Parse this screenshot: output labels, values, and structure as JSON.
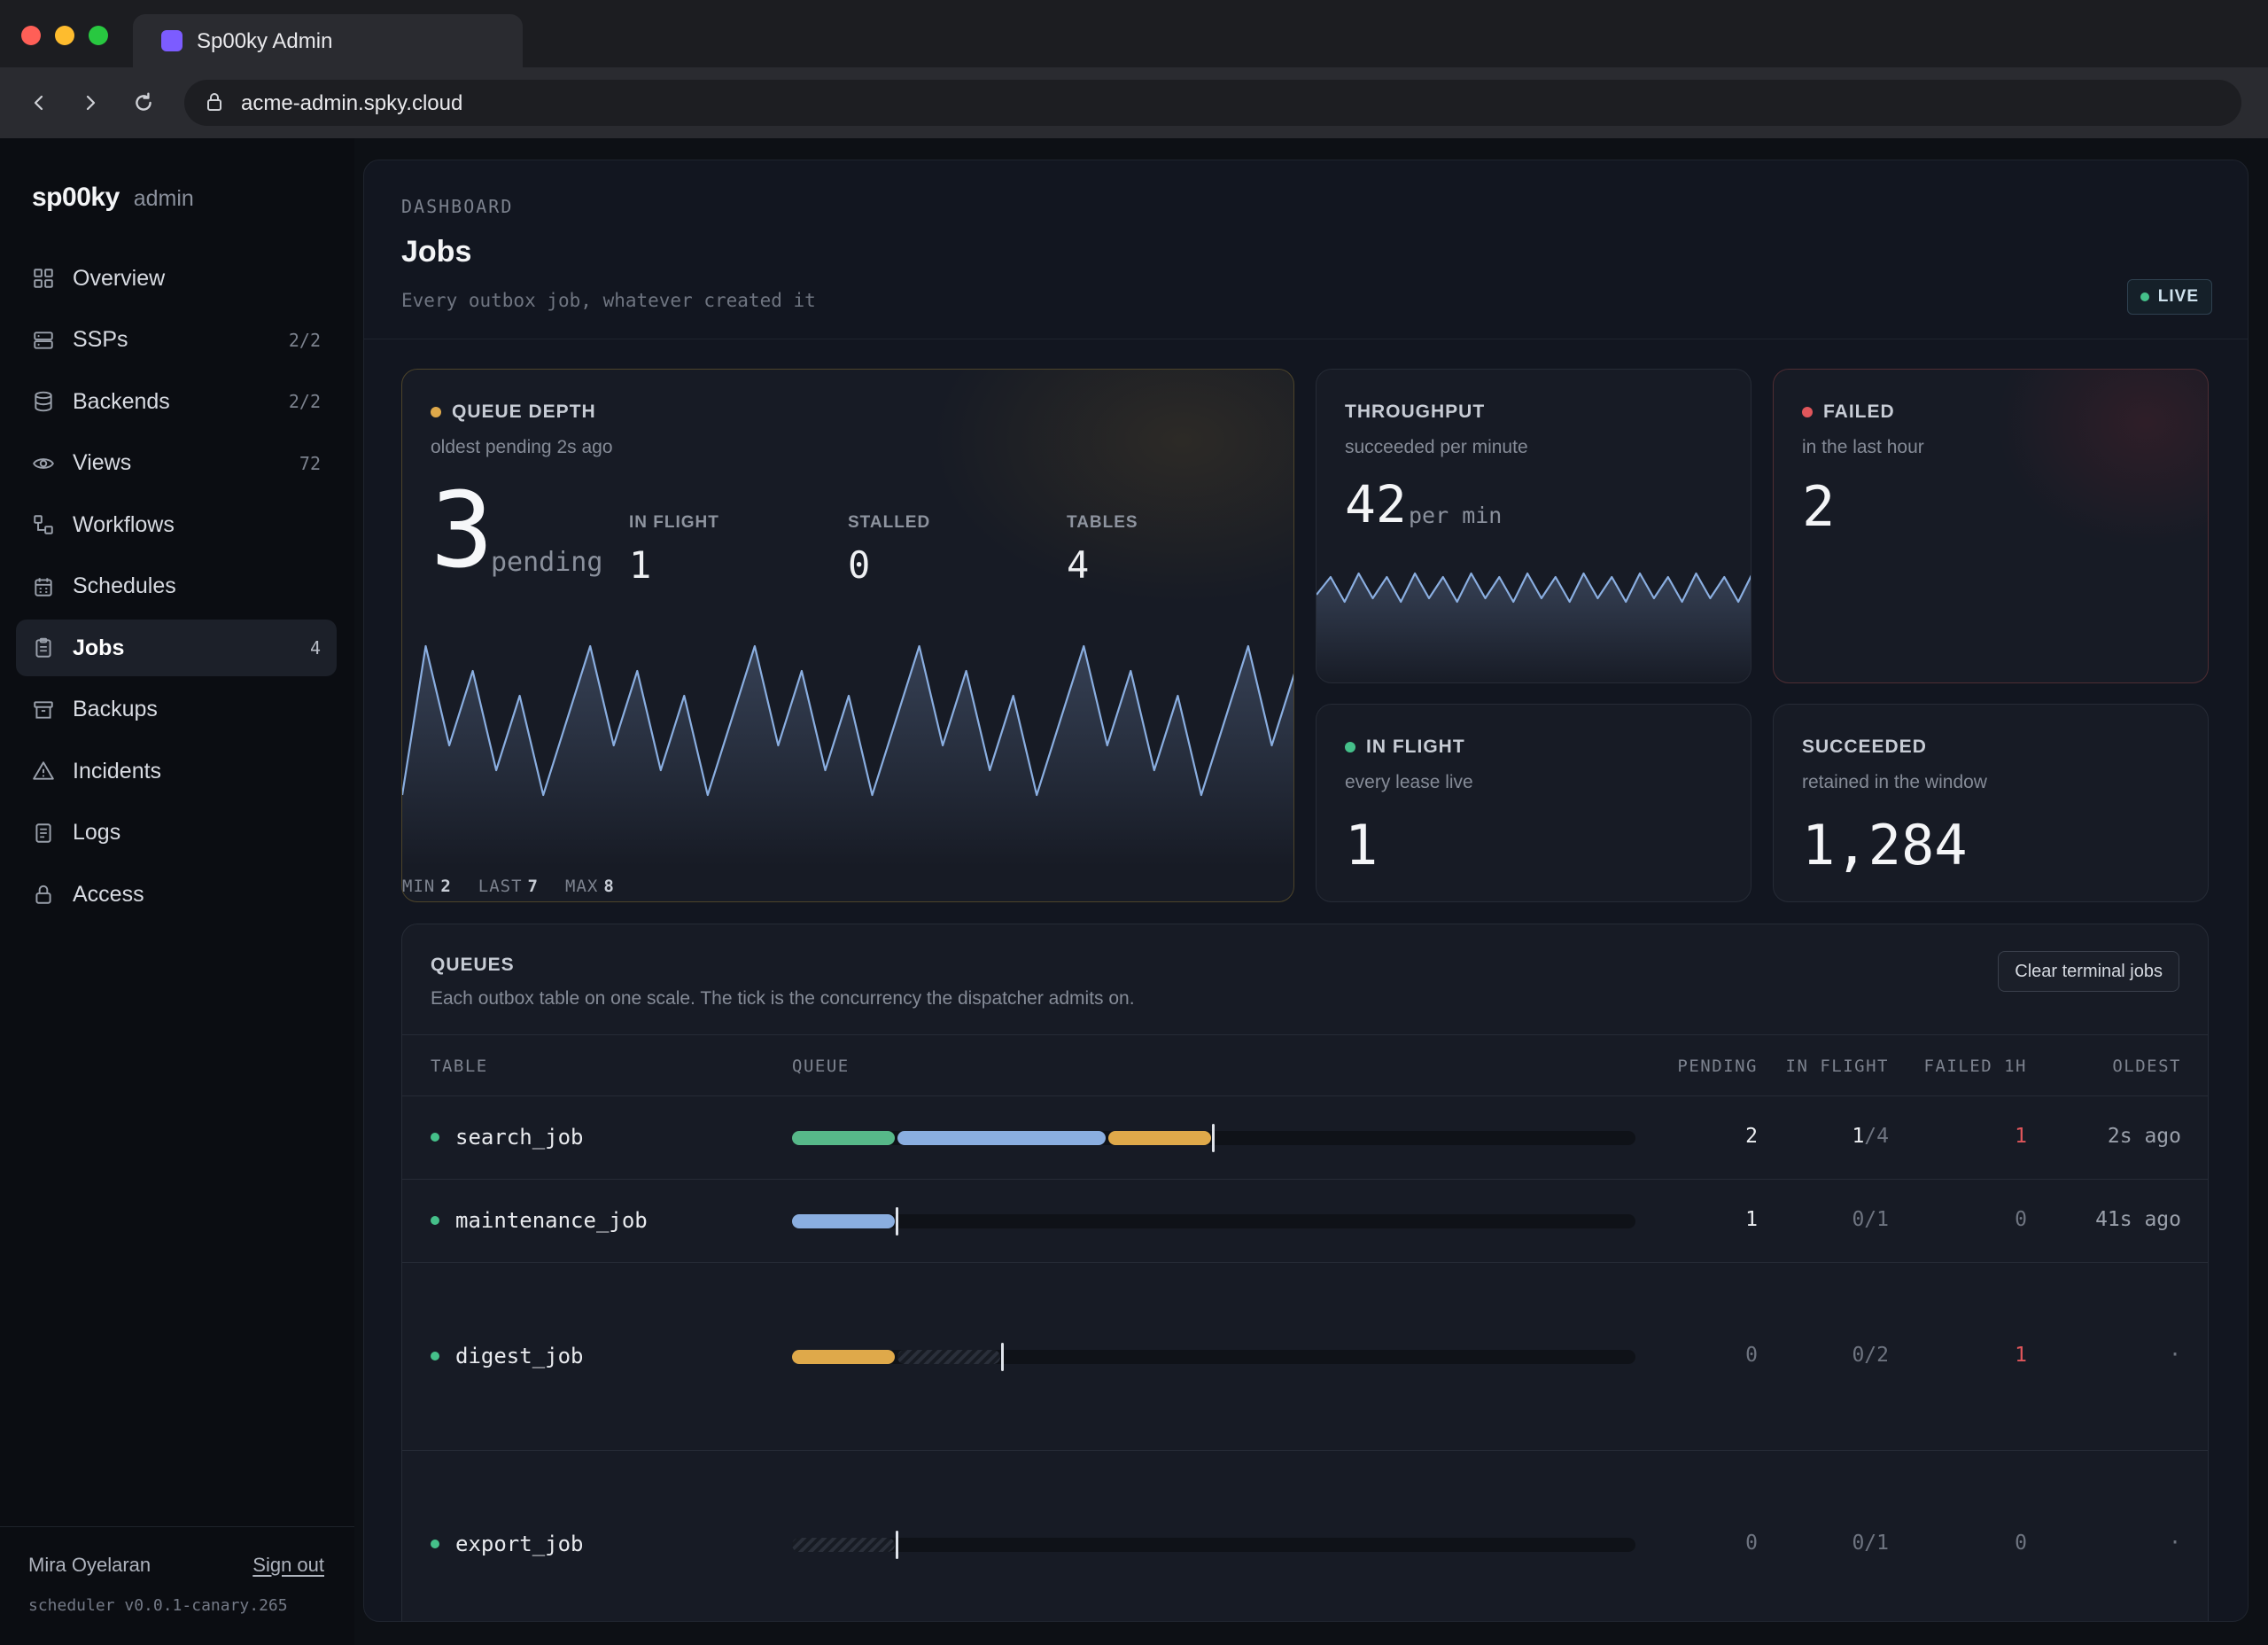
{
  "browser": {
    "tab_title": "Sp00ky Admin",
    "url": "acme-admin.spky.cloud",
    "traffic_colors": [
      "#ff5f57",
      "#febc2e",
      "#28c840"
    ]
  },
  "sidebar": {
    "brand": "sp00ky",
    "brand_sub": "admin",
    "items": [
      {
        "label": "Overview",
        "count": "",
        "icon": "grid-icon"
      },
      {
        "label": "SSPs",
        "count": "2/2",
        "icon": "server-icon"
      },
      {
        "label": "Backends",
        "count": "2/2",
        "icon": "database-icon"
      },
      {
        "label": "Views",
        "count": "72",
        "icon": "eye-icon"
      },
      {
        "label": "Workflows",
        "count": "",
        "icon": "workflow-icon"
      },
      {
        "label": "Schedules",
        "count": "",
        "icon": "calendar-icon"
      },
      {
        "label": "Jobs",
        "count": "4",
        "icon": "clipboard-icon",
        "active": true
      },
      {
        "label": "Backups",
        "count": "",
        "icon": "archive-icon"
      },
      {
        "label": "Incidents",
        "count": "",
        "icon": "warning-icon"
      },
      {
        "label": "Logs",
        "count": "",
        "icon": "document-icon"
      },
      {
        "label": "Access",
        "count": "",
        "icon": "lock-icon"
      }
    ],
    "user": "Mira Oyelaran",
    "signout": "Sign out",
    "version": "scheduler v0.0.1-canary.265"
  },
  "header": {
    "eyebrow": "DASHBOARD",
    "title": "Jobs",
    "subtitle": "Every outbox job, whatever created it",
    "live_label": "LIVE"
  },
  "queue_depth": {
    "label": "QUEUE DEPTH",
    "sub": "oldest pending 2s ago",
    "value": "3",
    "unit": "pending",
    "stats": [
      {
        "k": "IN FLIGHT",
        "v": "1"
      },
      {
        "k": "STALLED",
        "v": "0"
      },
      {
        "k": "TABLES",
        "v": "4"
      }
    ],
    "footer": {
      "min_k": "MIN",
      "min_v": "2",
      "last_k": "LAST",
      "last_v": "7",
      "max_k": "MAX",
      "max_v": "8"
    },
    "spark": [
      2,
      8,
      4,
      7,
      3,
      6,
      2,
      5,
      8,
      4,
      7,
      3,
      6,
      2,
      5,
      8,
      4,
      7,
      3,
      6,
      2,
      5,
      8,
      4,
      7,
      3,
      6,
      2,
      5,
      8,
      4,
      7,
      3,
      6,
      2,
      5,
      8,
      4,
      7
    ],
    "dot_color": "#dfa94a",
    "line_color": "#8aaee0"
  },
  "throughput": {
    "label": "THROUGHPUT",
    "sub": "succeeded per minute",
    "value": "42",
    "unit": "per min",
    "spark": [
      40,
      45,
      38,
      46,
      39,
      45,
      38,
      46,
      39,
      45,
      38,
      46,
      39,
      45,
      38,
      46,
      39,
      45,
      38,
      46,
      39,
      45,
      38,
      46,
      39,
      45,
      38,
      46,
      39,
      45,
      38,
      46
    ]
  },
  "failed": {
    "label": "FAILED",
    "sub": "in the last hour",
    "value": "2",
    "dot_color": "#e0565b"
  },
  "in_flight": {
    "label": "IN FLIGHT",
    "sub": "every lease live",
    "value": "1",
    "dot_color": "#45c08a"
  },
  "succeeded": {
    "label": "SUCCEEDED",
    "sub": "retained in the window",
    "value": "1,284"
  },
  "queues": {
    "title": "QUEUES",
    "subtitle": "Each outbox table on one scale. The tick is the concurrency the dispatcher admits on.",
    "button": "Clear terminal jobs",
    "columns": {
      "table": "TABLE",
      "queue": "QUEUE",
      "pending": "PENDING",
      "in_flight": "IN FLIGHT",
      "failed": "FAILED 1H",
      "oldest": "OLDEST"
    },
    "scale_max": 8,
    "rows": [
      {
        "name": "search_job",
        "pending": "2",
        "in_flight": "1",
        "in_flight_cap": "/4",
        "failed": "1",
        "oldest": "2s ago",
        "segments": [
          {
            "kind": "g",
            "n": 1
          },
          {
            "kind": "b",
            "n": 2
          },
          {
            "kind": "y",
            "n": 1
          }
        ],
        "tick": 4
      },
      {
        "name": "maintenance_job",
        "pending": "1",
        "in_flight": "0",
        "in_flight_cap": "/1",
        "failed": "0",
        "oldest": "41s ago",
        "segments": [
          {
            "kind": "b",
            "n": 1
          }
        ],
        "tick": 1
      },
      {
        "name": "digest_job",
        "pending": "0",
        "in_flight": "0",
        "in_flight_cap": "/2",
        "failed": "1",
        "oldest": "·",
        "segments": [
          {
            "kind": "y",
            "n": 1
          },
          {
            "kind": "h",
            "n": 1
          }
        ],
        "tick": 2
      },
      {
        "name": "export_job",
        "pending": "0",
        "in_flight": "0",
        "in_flight_cap": "/1",
        "failed": "0",
        "oldest": "·",
        "segments": [
          {
            "kind": "h",
            "n": 1
          }
        ],
        "tick": 1
      }
    ]
  }
}
